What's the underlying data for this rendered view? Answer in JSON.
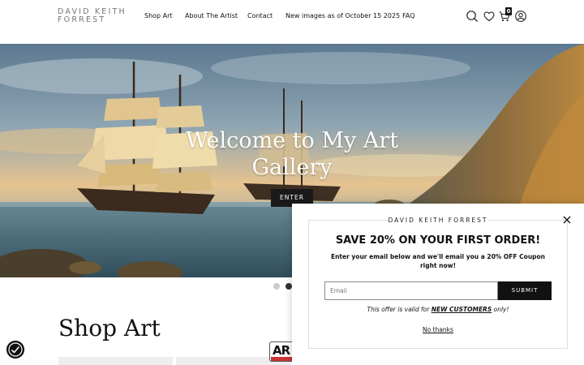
{
  "header": {
    "logo_line1": "DAVID KEITH",
    "logo_line2": "FORREST",
    "nav": {
      "shop_art": "Shop Art",
      "about": "About The Artist",
      "contact": "Contact",
      "new_images": "New images as of October 15 2025",
      "faq": "FAQ"
    },
    "icons": [
      "search-icon",
      "heart-icon",
      "cart-icon",
      "user-icon"
    ],
    "cart_count": "0"
  },
  "hero": {
    "title": "Welcome to My Art Gallery",
    "button_label": "ENTER",
    "slide_count": 2,
    "active_slide": 2
  },
  "main": {
    "section_title": "Shop Art",
    "badge_text": "AR"
  },
  "popup": {
    "brand": "DAVID KEITH FORREST",
    "headline": "SAVE 20% ON YOUR FIRST ORDER!",
    "subtext": "Enter your email below and we'll email you a 20% OFF Coupon right now!",
    "email_placeholder": "Email",
    "submit_label": "SUBMIT",
    "offer_prefix": "This offer is valid for ",
    "offer_highlight": "NEW CUSTOMERS",
    "offer_suffix": " only!",
    "decline_label": "No thanks"
  },
  "colors": {
    "button_dark": "#111111",
    "active_dot": "#333333",
    "inactive_dot": "#cccccc"
  }
}
